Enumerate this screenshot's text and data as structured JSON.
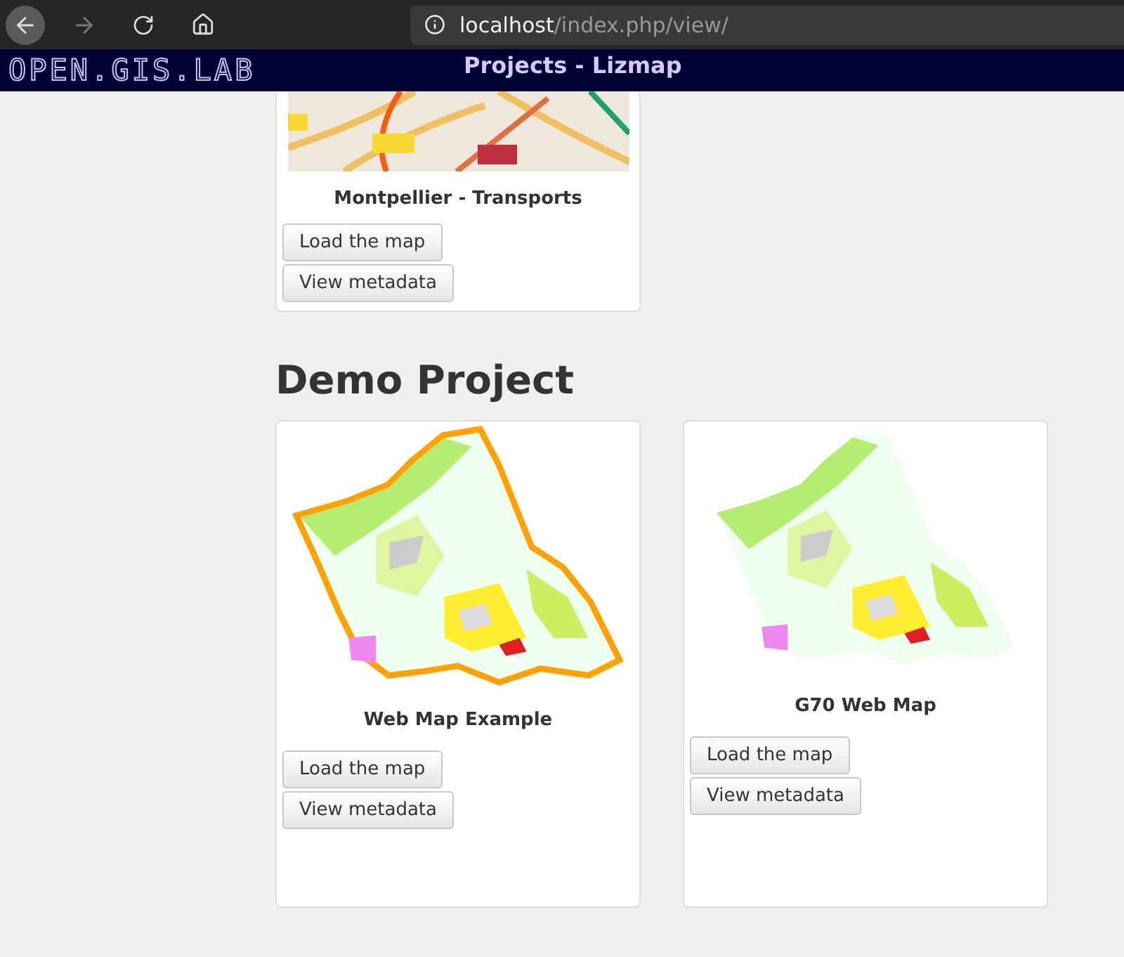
{
  "browser": {
    "url_host": "localhost",
    "url_path": "/index.php/view/"
  },
  "header": {
    "logo": "OPEN.GIS.LAB",
    "title": "Projects - Lizmap"
  },
  "groups": [
    {
      "projects": [
        {
          "title": "Montpellier - Transports",
          "kind": "road-map",
          "buttons": [
            "Load the map",
            "View metadata"
          ]
        }
      ]
    },
    {
      "heading": "Demo Project",
      "projects": [
        {
          "title": "Web Map Example",
          "kind": "island-coast",
          "buttons": [
            "Load the map",
            "View metadata"
          ]
        },
        {
          "title": "G70 Web Map",
          "kind": "island",
          "buttons": [
            "Load the map",
            "View metadata"
          ]
        }
      ]
    }
  ]
}
